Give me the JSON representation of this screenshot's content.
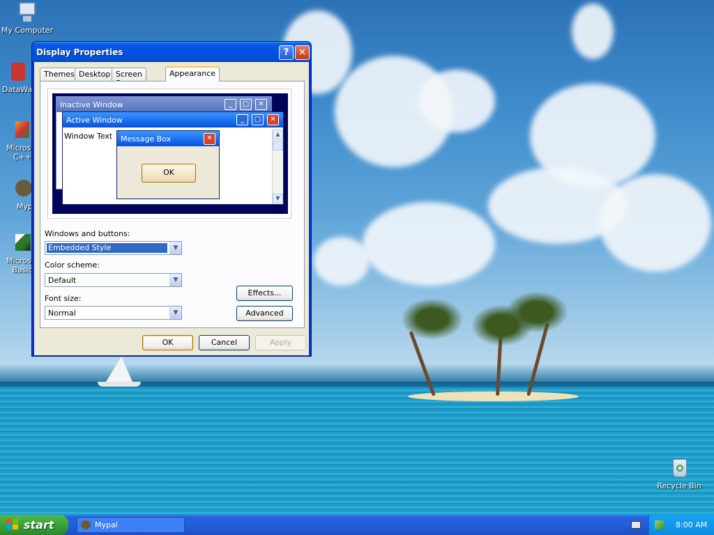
{
  "desktop": {
    "icons": [
      {
        "label": "My Computer"
      },
      {
        "label": "DataWa"
      },
      {
        "label": "Microsof C++"
      },
      {
        "label": "Myp"
      },
      {
        "label": "Microsof Basic"
      },
      {
        "label": "Recycle Bin"
      }
    ]
  },
  "window": {
    "title": "Display Properties",
    "help_btn": "?",
    "close_btn": "✕",
    "tabs": [
      {
        "label": "Themes"
      },
      {
        "label": "Desktop"
      },
      {
        "label": "Screen Saver"
      },
      {
        "label": "Appearance",
        "active": true
      }
    ],
    "preview": {
      "inactive_title": "Inactive Window",
      "active_title": "Active Window",
      "window_text": "Window Text",
      "message_title": "Message Box",
      "ok": "OK"
    },
    "windows_buttons_label": "Windows and buttons:",
    "windows_buttons_value": "Embedded Style",
    "color_scheme_label": "Color scheme:",
    "color_scheme_value": "Default",
    "font_size_label": "Font size:",
    "font_size_value": "Normal",
    "effects_btn": "Effects...",
    "advanced_btn": "Advanced",
    "ok_btn": "OK",
    "cancel_btn": "Cancel",
    "apply_btn": "Apply"
  },
  "taskbar": {
    "start_label": "start",
    "task_label": "Mypal",
    "clock": "8:00 AM"
  },
  "colors": {
    "accent": "#0a5fe8",
    "start_green": "#379d36"
  }
}
